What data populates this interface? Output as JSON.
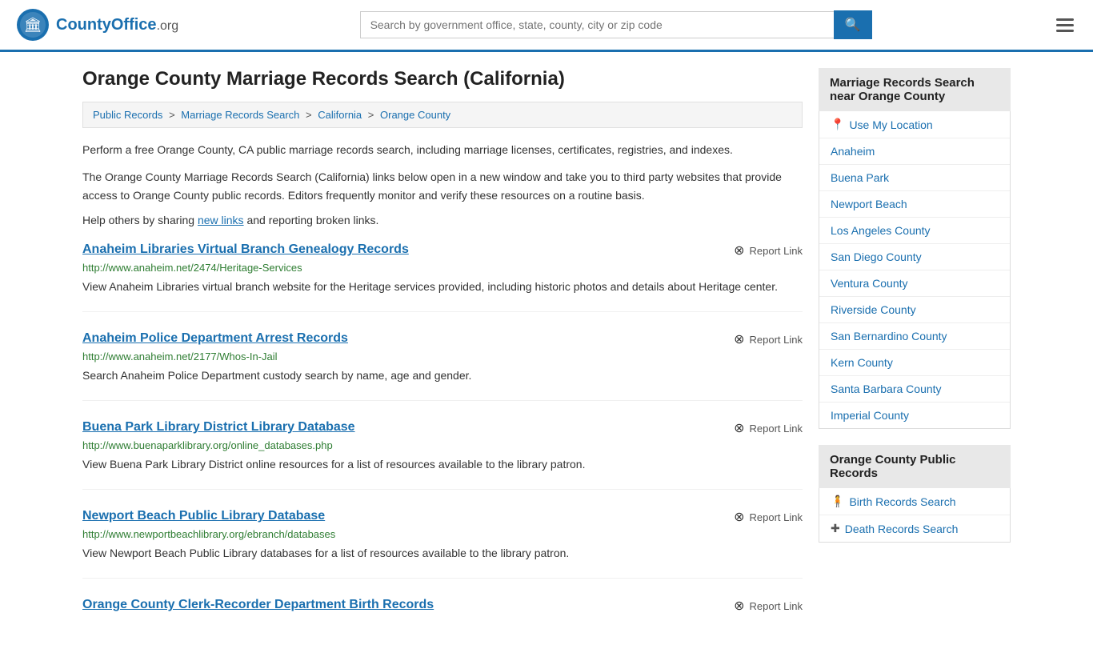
{
  "header": {
    "logo_text": "CountyOffice",
    "logo_suffix": ".org",
    "search_placeholder": "Search by government office, state, county, city or zip code",
    "search_value": ""
  },
  "page": {
    "title": "Orange County Marriage Records Search (California)",
    "breadcrumb": {
      "items": [
        {
          "label": "Public Records",
          "url": "#"
        },
        {
          "label": "Marriage Records Search",
          "url": "#"
        },
        {
          "label": "California",
          "url": "#"
        },
        {
          "label": "Orange County",
          "url": "#"
        }
      ]
    },
    "intro_paragraphs": [
      "Perform a free Orange County, CA public marriage records search, including marriage licenses, certificates, registries, and indexes.",
      "The Orange County Marriage Records Search (California) links below open in a new window and take you to third party websites that provide access to Orange County public records. Editors frequently monitor and verify these resources on a routine basis."
    ],
    "share_text_before": "Help others by sharing ",
    "share_link_label": "new links",
    "share_text_after": " and reporting broken links."
  },
  "results": [
    {
      "title": "Anaheim Libraries Virtual Branch Genealogy Records",
      "url": "http://www.anaheim.net/2474/Heritage-Services",
      "description": "View Anaheim Libraries virtual branch website for the Heritage services provided, including historic photos and details about Heritage center.",
      "report_label": "Report Link"
    },
    {
      "title": "Anaheim Police Department Arrest Records",
      "url": "http://www.anaheim.net/2177/Whos-In-Jail",
      "description": "Search Anaheim Police Department custody search by name, age and gender.",
      "report_label": "Report Link"
    },
    {
      "title": "Buena Park Library District Library Database",
      "url": "http://www.buenaparklibrary.org/online_databases.php",
      "description": "View Buena Park Library District online resources for a list of resources available to the library patron.",
      "report_label": "Report Link"
    },
    {
      "title": "Newport Beach Public Library Database",
      "url": "http://www.newportbeachlibrary.org/ebranch/databases",
      "description": "View Newport Beach Public Library databases for a list of resources available to the library patron.",
      "report_label": "Report Link"
    },
    {
      "title": "Orange County Clerk-Recorder Department Birth Records",
      "url": "",
      "description": "",
      "report_label": "Report Link"
    }
  ],
  "sidebar": {
    "nearby_header": "Marriage Records Search near Orange County",
    "use_my_location": "Use My Location",
    "nearby_places": [
      {
        "label": "Anaheim",
        "url": "#"
      },
      {
        "label": "Buena Park",
        "url": "#"
      },
      {
        "label": "Newport Beach",
        "url": "#"
      },
      {
        "label": "Los Angeles County",
        "url": "#"
      },
      {
        "label": "San Diego County",
        "url": "#"
      },
      {
        "label": "Ventura County",
        "url": "#"
      },
      {
        "label": "Riverside County",
        "url": "#"
      },
      {
        "label": "San Bernardino County",
        "url": "#"
      },
      {
        "label": "Kern County",
        "url": "#"
      },
      {
        "label": "Santa Barbara County",
        "url": "#"
      },
      {
        "label": "Imperial County",
        "url": "#"
      }
    ],
    "public_records_header": "Orange County Public Records",
    "public_records_links": [
      {
        "label": "Birth Records Search",
        "icon": "person",
        "url": "#"
      },
      {
        "label": "Death Records Search",
        "icon": "cross",
        "url": "#"
      }
    ]
  }
}
